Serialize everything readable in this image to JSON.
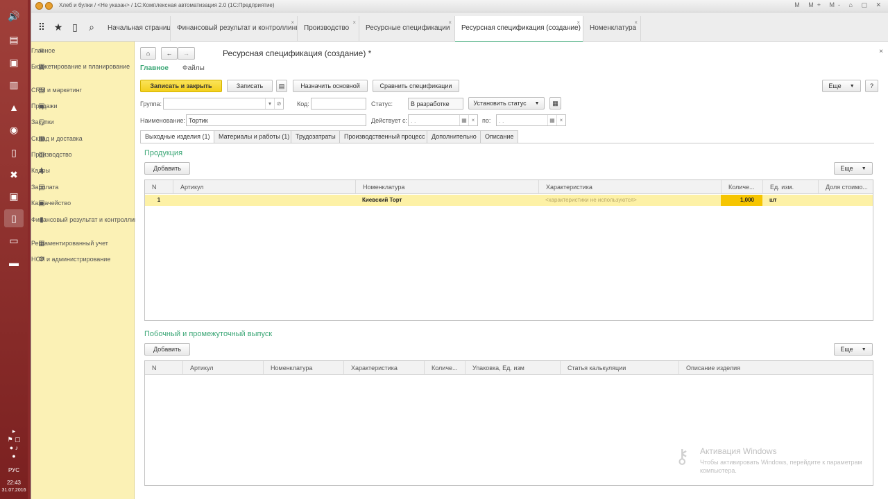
{
  "window": {
    "title": "Хлеб и булки / <Не указан> / 1С:Комплексная автоматизация 2.0  (1С:Предприятие)",
    "controls": "M M+ M- ⌂ ▢ ✕"
  },
  "tabs": [
    {
      "label": "Начальная страница"
    },
    {
      "label": "Финансовый результат и контроллинг"
    },
    {
      "label": "Производство"
    },
    {
      "label": "Ресурсные спецификации"
    },
    {
      "label": "Ресурсная спецификация (создание) *"
    },
    {
      "label": "Номенклатура"
    }
  ],
  "sidebar": {
    "items": [
      {
        "icon": "menu-icon",
        "label": "Главное"
      },
      {
        "icon": "budget-icon",
        "label": "Бюджетирование и планирование"
      },
      {
        "icon": "crm-icon",
        "label": "CRM и маркетинг"
      },
      {
        "icon": "sales-icon",
        "label": "Продажи"
      },
      {
        "icon": "purchases-icon",
        "label": "Закупки"
      },
      {
        "icon": "warehouse-icon",
        "label": "Склад и доставка"
      },
      {
        "icon": "production-icon",
        "label": "Производство"
      },
      {
        "icon": "staff-icon",
        "label": "Кадры"
      },
      {
        "icon": "salary-icon",
        "label": "Зарплата"
      },
      {
        "icon": "treasury-icon",
        "label": "Казначейство"
      },
      {
        "icon": "chart-icon",
        "label": "Финансовый результат и контроллинг"
      },
      {
        "icon": "accounting-icon",
        "label": "Регламентированный учет"
      },
      {
        "icon": "gear-icon",
        "label": "НСИ и администрирование"
      }
    ]
  },
  "form": {
    "title": "Ресурсная спецификация (создание) *",
    "links": {
      "main": "Главное",
      "files": "Файлы"
    },
    "buttons": {
      "save_close": "Записать и закрыть",
      "save": "Записать",
      "set_main": "Назначить основной",
      "compare": "Сравнить спецификации",
      "more": "Еще",
      "help": "?",
      "set_status": "Установить статус"
    },
    "fields": {
      "group_label": "Группа:",
      "group_value": "",
      "code_label": "Код:",
      "code_value": "",
      "status_label": "Статус:",
      "status_value": "В разработке",
      "name_label": "Наименование:",
      "name_value": "Тортик",
      "valid_from_label": "Действует с:",
      "valid_from_value": ".  .",
      "to_label": "по:",
      "to_value": ".  ."
    },
    "subtabs": [
      {
        "label": "Выходные изделия (1)"
      },
      {
        "label": "Материалы и работы (1)"
      },
      {
        "label": "Трудозатраты"
      },
      {
        "label": "Производственный процесс"
      },
      {
        "label": "Дополнительно"
      },
      {
        "label": "Описание"
      }
    ]
  },
  "products": {
    "title": "Продукция",
    "add": "Добавить",
    "more": "Еще",
    "columns": [
      "N",
      "Артикул",
      "Номенклатура",
      "Характеристика",
      "Количе...",
      "Ед. изм.",
      "Доля стоимо..."
    ],
    "rows": [
      {
        "n": "1",
        "article": "",
        "item": "Киевский Торт",
        "characteristic": "<характеристики не используются>",
        "qty": "1,000",
        "unit": "шт",
        "share": ""
      }
    ]
  },
  "byproducts": {
    "title": "Побочный и промежуточный  выпуск",
    "add": "Добавить",
    "more": "Еще",
    "columns": [
      "N",
      "Артикул",
      "Номенклатура",
      "Характеристика",
      "Количе...",
      "Упаковка, Ед. изм",
      "Статья калькуляции",
      "Описание изделия"
    ]
  },
  "activation": {
    "title": "Активация Windows",
    "line1": "Чтобы активировать Windows, перейдите к параметрам",
    "line2": "компьютера."
  },
  "tray": {
    "lang": "РУС",
    "time": "22:43",
    "date": "31.07.2016"
  }
}
